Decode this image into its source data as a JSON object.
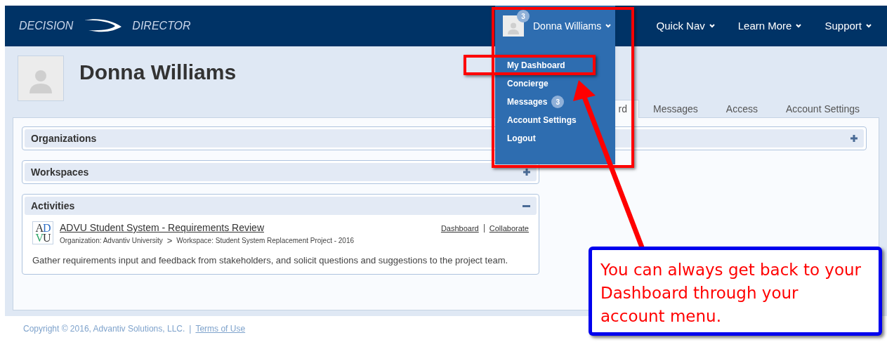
{
  "navbar": {
    "brand": [
      "DECISION",
      "DIRECTOR"
    ],
    "user_menu": {
      "badge": "3",
      "label": "Donna Williams",
      "expanded": true
    },
    "menus": [
      "Quick Nav",
      "Learn More",
      "Support"
    ]
  },
  "dropdown": [
    {
      "label": "My Dashboard",
      "annotated": true
    },
    {
      "label": "Concierge",
      "annotated": false
    },
    {
      "label": "Messages",
      "badge": "3",
      "annotated": false
    },
    {
      "label": "Account Settings",
      "annotated": false
    },
    {
      "label": "Logout",
      "annotated": false
    }
  ],
  "profile": {
    "name": "Donna Williams"
  },
  "tabs": [
    {
      "label": "rd",
      "selected": true
    },
    {
      "label": "Messages",
      "selected": false
    },
    {
      "label": "Access",
      "selected": false
    },
    {
      "label": "Account Settings",
      "selected": false
    }
  ],
  "panels": [
    {
      "title": "Organizations",
      "kind": "wide",
      "expanded": false
    },
    {
      "title": "Workspaces",
      "kind": "narrow",
      "expanded": false
    },
    {
      "title": "Activities",
      "kind": "narrow",
      "expanded": true
    }
  ],
  "activity": {
    "logo_lines": [
      "AD",
      "VU"
    ],
    "title": "ADVU Student System - Requirements Review",
    "breadcrumb": [
      "Organization: Advantiv University",
      ">",
      "Workspace: Student System Replacement Project - 2016"
    ],
    "links": [
      "Dashboard",
      "Collaborate"
    ],
    "description": "Gather requirements input and feedback from stakeholders, and solicit questions and suggestions to the project team."
  },
  "footer": {
    "copyright": "Copyright © 2016, Advantiv Solutions, LLC.",
    "separator": "|",
    "link": "Terms of Use"
  },
  "callout": {
    "text": "You can always get back to your Dashboard through your account menu."
  }
}
